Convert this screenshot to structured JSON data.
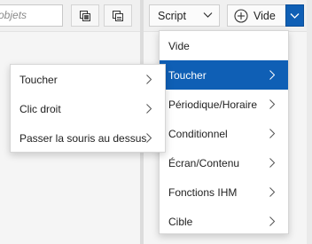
{
  "toolbar": {
    "search_placeholder": "objets",
    "script_label": "Script",
    "new_label": "Vide"
  },
  "main_menu": {
    "items": [
      {
        "label": "Vide",
        "submenu": false
      },
      {
        "label": "Toucher",
        "submenu": true,
        "active": true
      },
      {
        "label": "Périodique/Horaire",
        "submenu": true
      },
      {
        "label": "Conditionnel",
        "submenu": true
      },
      {
        "label": "Écran/Contenu",
        "submenu": true
      },
      {
        "label": "Fonctions IHM",
        "submenu": true
      },
      {
        "label": "Cible",
        "submenu": true
      }
    ]
  },
  "sub_menu": {
    "items": [
      {
        "label": "Toucher"
      },
      {
        "label": "Clic droit"
      },
      {
        "label": "Passer la souris au dessus"
      }
    ]
  },
  "colors": {
    "accent": "#0f5fb5",
    "menu_background": "#ffffff",
    "pane_background": "#f5f5f5"
  }
}
